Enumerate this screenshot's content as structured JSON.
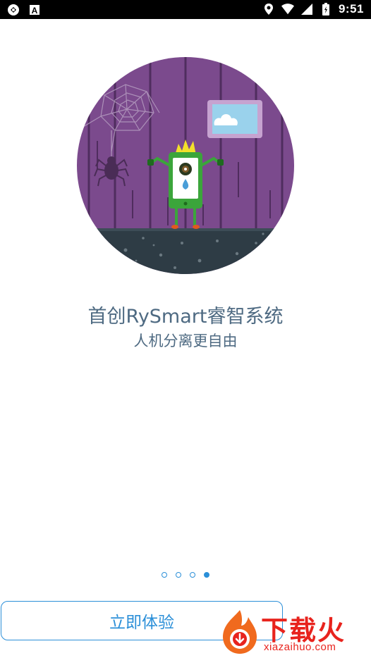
{
  "status_bar": {
    "time": "9:51",
    "left_icons": [
      "sync-icon",
      "a-notification-icon"
    ],
    "right_icons": [
      "location-icon",
      "wifi-icon",
      "signal-icon",
      "battery-icon"
    ]
  },
  "onboarding": {
    "title": "首创RySmart睿智系统",
    "subtitle": "人机分离更自由",
    "page_count": 4,
    "active_page": 4,
    "start_button_label": "立即体验"
  },
  "watermark": {
    "brand": "下载火",
    "url": "xiazaihuo.com"
  },
  "colors": {
    "accent": "#2b8fd8",
    "text": "#4e6a82",
    "wall": "#7b4a8d",
    "floor": "#2e3c45",
    "phone_green": "#3ba53b",
    "watermark_red": "#e8231d"
  }
}
